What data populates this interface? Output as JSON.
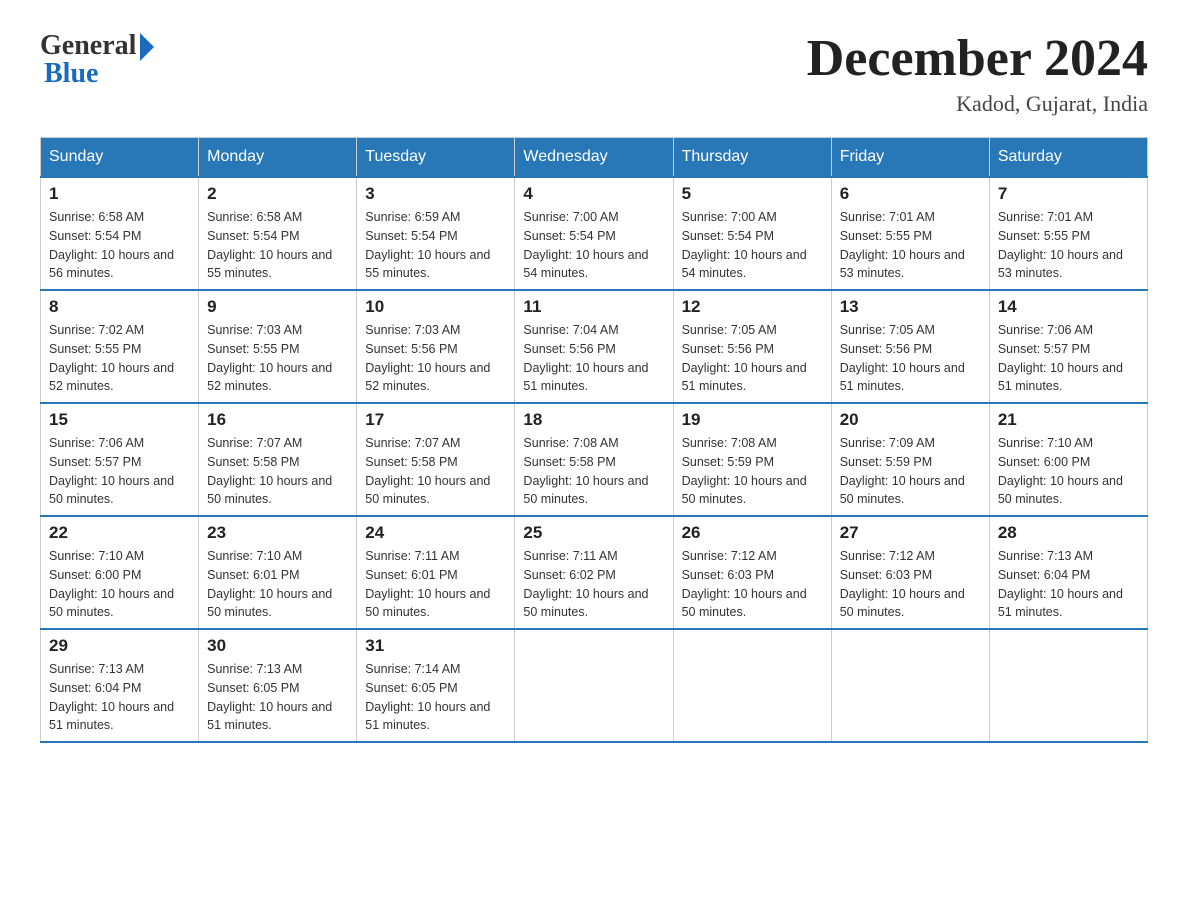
{
  "logo": {
    "general": "General",
    "blue": "Blue"
  },
  "title": "December 2024",
  "location": "Kadod, Gujarat, India",
  "days_of_week": [
    "Sunday",
    "Monday",
    "Tuesday",
    "Wednesday",
    "Thursday",
    "Friday",
    "Saturday"
  ],
  "weeks": [
    [
      {
        "day": "1",
        "sunrise": "6:58 AM",
        "sunset": "5:54 PM",
        "daylight": "10 hours and 56 minutes."
      },
      {
        "day": "2",
        "sunrise": "6:58 AM",
        "sunset": "5:54 PM",
        "daylight": "10 hours and 55 minutes."
      },
      {
        "day": "3",
        "sunrise": "6:59 AM",
        "sunset": "5:54 PM",
        "daylight": "10 hours and 55 minutes."
      },
      {
        "day": "4",
        "sunrise": "7:00 AM",
        "sunset": "5:54 PM",
        "daylight": "10 hours and 54 minutes."
      },
      {
        "day": "5",
        "sunrise": "7:00 AM",
        "sunset": "5:54 PM",
        "daylight": "10 hours and 54 minutes."
      },
      {
        "day": "6",
        "sunrise": "7:01 AM",
        "sunset": "5:55 PM",
        "daylight": "10 hours and 53 minutes."
      },
      {
        "day": "7",
        "sunrise": "7:01 AM",
        "sunset": "5:55 PM",
        "daylight": "10 hours and 53 minutes."
      }
    ],
    [
      {
        "day": "8",
        "sunrise": "7:02 AM",
        "sunset": "5:55 PM",
        "daylight": "10 hours and 52 minutes."
      },
      {
        "day": "9",
        "sunrise": "7:03 AM",
        "sunset": "5:55 PM",
        "daylight": "10 hours and 52 minutes."
      },
      {
        "day": "10",
        "sunrise": "7:03 AM",
        "sunset": "5:56 PM",
        "daylight": "10 hours and 52 minutes."
      },
      {
        "day": "11",
        "sunrise": "7:04 AM",
        "sunset": "5:56 PM",
        "daylight": "10 hours and 51 minutes."
      },
      {
        "day": "12",
        "sunrise": "7:05 AM",
        "sunset": "5:56 PM",
        "daylight": "10 hours and 51 minutes."
      },
      {
        "day": "13",
        "sunrise": "7:05 AM",
        "sunset": "5:56 PM",
        "daylight": "10 hours and 51 minutes."
      },
      {
        "day": "14",
        "sunrise": "7:06 AM",
        "sunset": "5:57 PM",
        "daylight": "10 hours and 51 minutes."
      }
    ],
    [
      {
        "day": "15",
        "sunrise": "7:06 AM",
        "sunset": "5:57 PM",
        "daylight": "10 hours and 50 minutes."
      },
      {
        "day": "16",
        "sunrise": "7:07 AM",
        "sunset": "5:58 PM",
        "daylight": "10 hours and 50 minutes."
      },
      {
        "day": "17",
        "sunrise": "7:07 AM",
        "sunset": "5:58 PM",
        "daylight": "10 hours and 50 minutes."
      },
      {
        "day": "18",
        "sunrise": "7:08 AM",
        "sunset": "5:58 PM",
        "daylight": "10 hours and 50 minutes."
      },
      {
        "day": "19",
        "sunrise": "7:08 AM",
        "sunset": "5:59 PM",
        "daylight": "10 hours and 50 minutes."
      },
      {
        "day": "20",
        "sunrise": "7:09 AM",
        "sunset": "5:59 PM",
        "daylight": "10 hours and 50 minutes."
      },
      {
        "day": "21",
        "sunrise": "7:10 AM",
        "sunset": "6:00 PM",
        "daylight": "10 hours and 50 minutes."
      }
    ],
    [
      {
        "day": "22",
        "sunrise": "7:10 AM",
        "sunset": "6:00 PM",
        "daylight": "10 hours and 50 minutes."
      },
      {
        "day": "23",
        "sunrise": "7:10 AM",
        "sunset": "6:01 PM",
        "daylight": "10 hours and 50 minutes."
      },
      {
        "day": "24",
        "sunrise": "7:11 AM",
        "sunset": "6:01 PM",
        "daylight": "10 hours and 50 minutes."
      },
      {
        "day": "25",
        "sunrise": "7:11 AM",
        "sunset": "6:02 PM",
        "daylight": "10 hours and 50 minutes."
      },
      {
        "day": "26",
        "sunrise": "7:12 AM",
        "sunset": "6:03 PM",
        "daylight": "10 hours and 50 minutes."
      },
      {
        "day": "27",
        "sunrise": "7:12 AM",
        "sunset": "6:03 PM",
        "daylight": "10 hours and 50 minutes."
      },
      {
        "day": "28",
        "sunrise": "7:13 AM",
        "sunset": "6:04 PM",
        "daylight": "10 hours and 51 minutes."
      }
    ],
    [
      {
        "day": "29",
        "sunrise": "7:13 AM",
        "sunset": "6:04 PM",
        "daylight": "10 hours and 51 minutes."
      },
      {
        "day": "30",
        "sunrise": "7:13 AM",
        "sunset": "6:05 PM",
        "daylight": "10 hours and 51 minutes."
      },
      {
        "day": "31",
        "sunrise": "7:14 AM",
        "sunset": "6:05 PM",
        "daylight": "10 hours and 51 minutes."
      },
      null,
      null,
      null,
      null
    ]
  ]
}
